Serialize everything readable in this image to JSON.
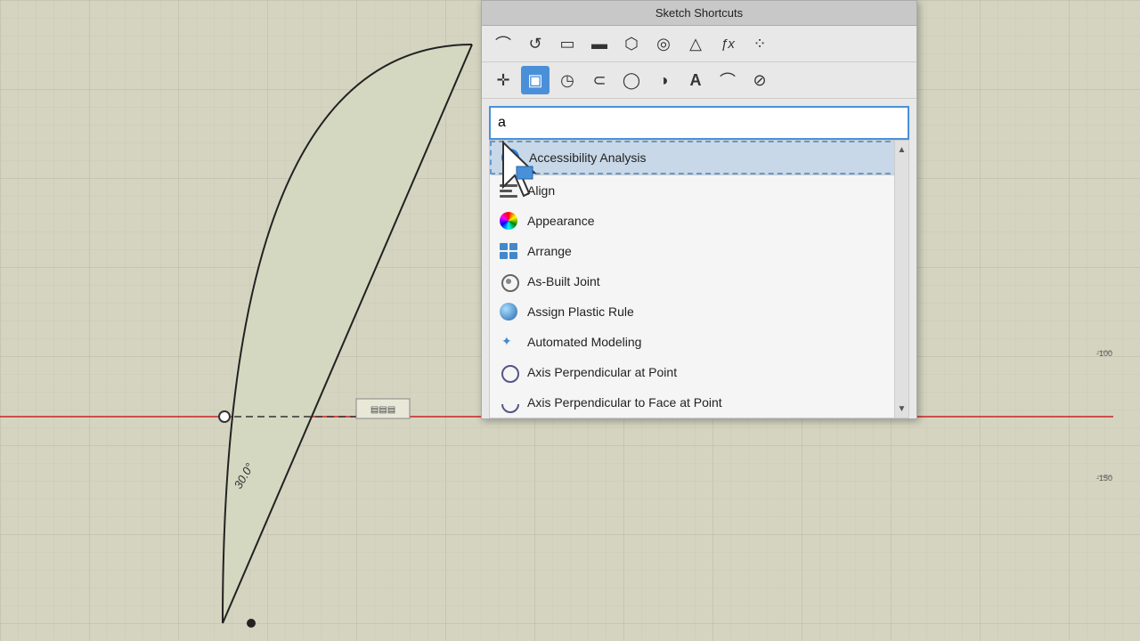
{
  "panel": {
    "title": "Sketch Shortcuts",
    "search": {
      "value": "a",
      "placeholder": ""
    },
    "toolbar_row1": {
      "icons": [
        "⌒",
        "↺",
        "▭",
        "▬",
        "⬡",
        "◎",
        "△",
        "ƒx",
        "⁘"
      ]
    },
    "toolbar_row2": {
      "icons": [
        "✛",
        "▣",
        "◷",
        "⊂",
        "◯",
        "◑",
        "A",
        "⌒",
        "⊘"
      ]
    },
    "dropdown_items": [
      {
        "id": "accessibility",
        "label": "Accessibility Analysis",
        "icon_type": "accessibility",
        "highlighted": true
      },
      {
        "id": "align",
        "label": "Align",
        "icon_type": "align"
      },
      {
        "id": "appearance",
        "label": "Appearance",
        "icon_type": "appearance"
      },
      {
        "id": "arrange",
        "label": "Arrange",
        "icon_type": "arrange"
      },
      {
        "id": "asbuilt",
        "label": "As-Built Joint",
        "icon_type": "asbuilt"
      },
      {
        "id": "plastic",
        "label": "Assign Plastic Rule",
        "icon_type": "plastic"
      },
      {
        "id": "automated",
        "label": "Automated Modeling",
        "icon_type": "automated"
      },
      {
        "id": "axis-point",
        "label": "Axis Perpendicular at Point",
        "icon_type": "axis"
      },
      {
        "id": "axis-face",
        "label": "Axis Perpendicular to Face at Point",
        "icon_type": "axis-face"
      }
    ]
  },
  "ruler": {
    "marks": [
      "-100",
      "-150"
    ]
  },
  "dimensions": {
    "angle": "30.0°",
    "x_val": "-100",
    "y_val": "-150"
  }
}
